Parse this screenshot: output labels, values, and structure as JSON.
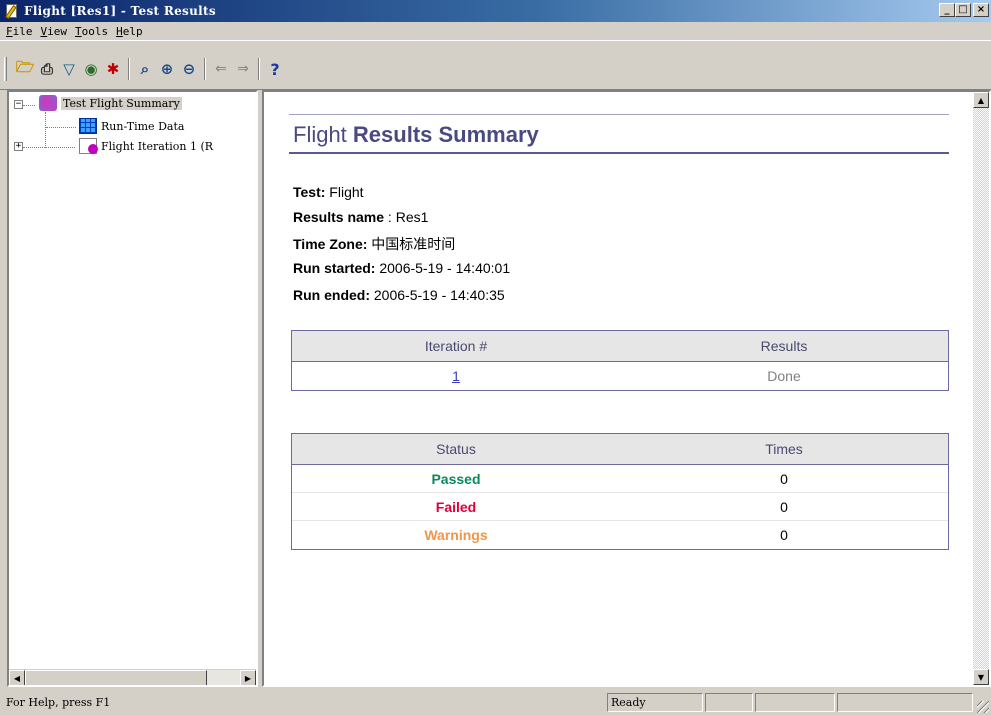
{
  "window": {
    "title": "Flight [Res1] - Test Results",
    "controls": {
      "minimize": "_",
      "maximize": "□",
      "close": "×"
    }
  },
  "menu": [
    "File",
    "View",
    "Tools",
    "Help"
  ],
  "toolbar": {
    "buttons": [
      "open-icon",
      "print-icon",
      "filter-icon",
      "find-icon",
      "bug-icon",
      "preview-icon",
      "zoom-in-icon",
      "zoom-out-icon",
      "back-arrow-icon",
      "forward-arrow-icon",
      "help-icon"
    ],
    "glyphs": {
      "open": "🗁",
      "print": "⎙",
      "filter": "▽",
      "find": "◉",
      "bug": "✱",
      "preview": "⌕",
      "zoom_in": "⊕",
      "zoom_out": "⊖",
      "back": "⇐",
      "forward": "⇒",
      "help": "?"
    }
  },
  "tree": {
    "items": [
      {
        "label": "Test Flight Summary",
        "icon": "summary-icon",
        "expander": "−"
      },
      {
        "label": "Run-Time Data",
        "icon": "grid-icon"
      },
      {
        "label": "Flight Iteration 1 (R",
        "icon": "iteration-icon",
        "expander": "+"
      }
    ],
    "scroll": {
      "left": "◀",
      "right": "▶"
    }
  },
  "summary": {
    "title_light": "Flight ",
    "title_bold": "Results Summary",
    "test_label": "Test:",
    "test_value": " Flight",
    "results_name_label": "Results name",
    "results_name_value": " : Res1",
    "time_zone_label": "Time Zone:",
    "time_zone_value": " 中国标准时间",
    "run_started_label": "Run started:",
    "run_started_value": " 2006-5-19 - 14:40:01",
    "run_ended_label": "Run ended:",
    "run_ended_value": " 2006-5-19 - 14:40:35"
  },
  "iterations_table": {
    "headers": [
      "Iteration #",
      "Results"
    ],
    "rows": [
      {
        "iteration": "1",
        "result": "Done"
      }
    ]
  },
  "status_table": {
    "headers": [
      "Status",
      "Times"
    ],
    "rows": [
      {
        "status": "Passed",
        "times": "0"
      },
      {
        "status": "Failed",
        "times": "0"
      },
      {
        "status": "Warnings",
        "times": "0"
      }
    ]
  },
  "content_scroll": {
    "up": "▲",
    "down": "▼"
  },
  "statusbar": {
    "help_text": "For Help, press F1",
    "state": "Ready"
  },
  "colors": {
    "passed": "#0a8a5a",
    "failed": "#e0003a",
    "warnings": "#f0964a",
    "link": "#3a3ac0",
    "title_bar": "#0a246a"
  }
}
